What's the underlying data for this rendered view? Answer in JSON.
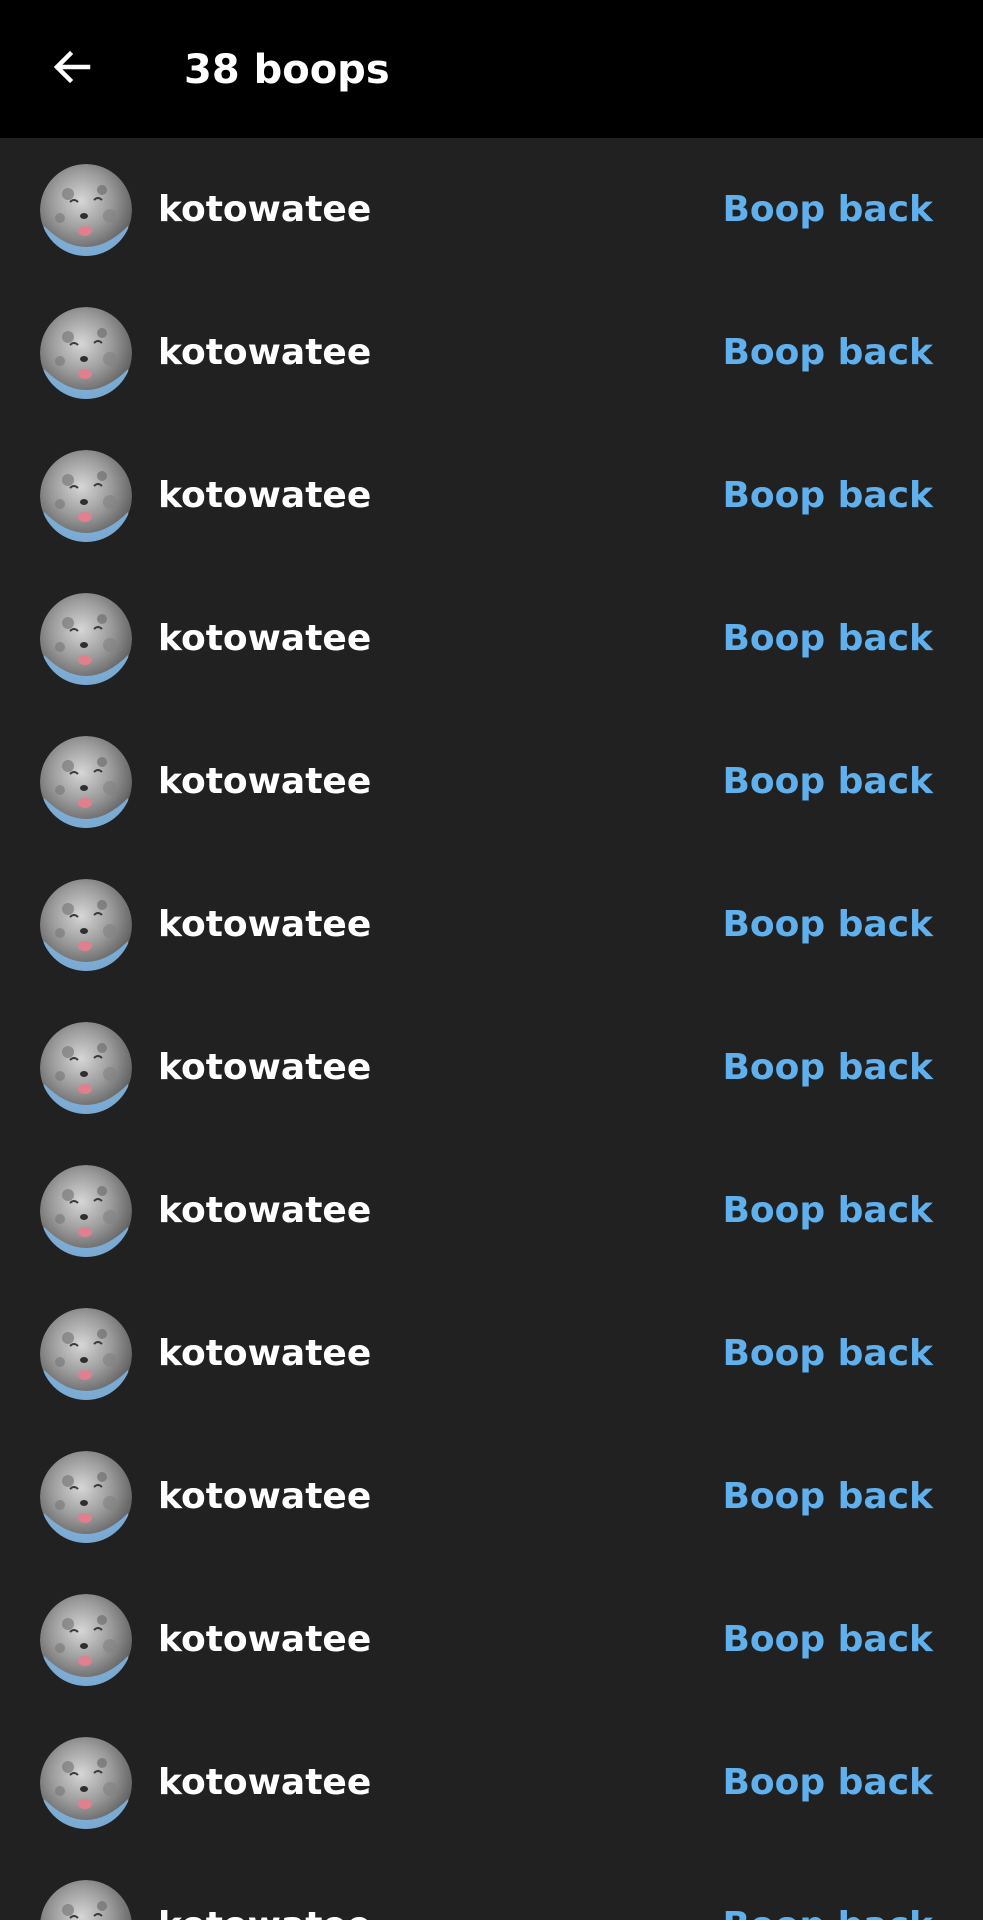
{
  "header": {
    "title": "38 boops",
    "back_icon": "arrow-left-icon"
  },
  "colors": {
    "header_bg": "#000000",
    "list_bg": "#212121",
    "username": "#ffffff",
    "action": "#5fb0ec"
  },
  "boops": [
    {
      "username": "kotowatee",
      "action": "Boop back",
      "avatar_icon": "moon-face-avatar"
    },
    {
      "username": "kotowatee",
      "action": "Boop back",
      "avatar_icon": "moon-face-avatar"
    },
    {
      "username": "kotowatee",
      "action": "Boop back",
      "avatar_icon": "moon-face-avatar"
    },
    {
      "username": "kotowatee",
      "action": "Boop back",
      "avatar_icon": "moon-face-avatar"
    },
    {
      "username": "kotowatee",
      "action": "Boop back",
      "avatar_icon": "moon-face-avatar"
    },
    {
      "username": "kotowatee",
      "action": "Boop back",
      "avatar_icon": "moon-face-avatar"
    },
    {
      "username": "kotowatee",
      "action": "Boop back",
      "avatar_icon": "moon-face-avatar"
    },
    {
      "username": "kotowatee",
      "action": "Boop back",
      "avatar_icon": "moon-face-avatar"
    },
    {
      "username": "kotowatee",
      "action": "Boop back",
      "avatar_icon": "moon-face-avatar"
    },
    {
      "username": "kotowatee",
      "action": "Boop back",
      "avatar_icon": "moon-face-avatar"
    },
    {
      "username": "kotowatee",
      "action": "Boop back",
      "avatar_icon": "moon-face-avatar"
    },
    {
      "username": "kotowatee",
      "action": "Boop back",
      "avatar_icon": "moon-face-avatar"
    },
    {
      "username": "kotowatee",
      "action": "Boop back",
      "avatar_icon": "moon-face-avatar"
    }
  ]
}
